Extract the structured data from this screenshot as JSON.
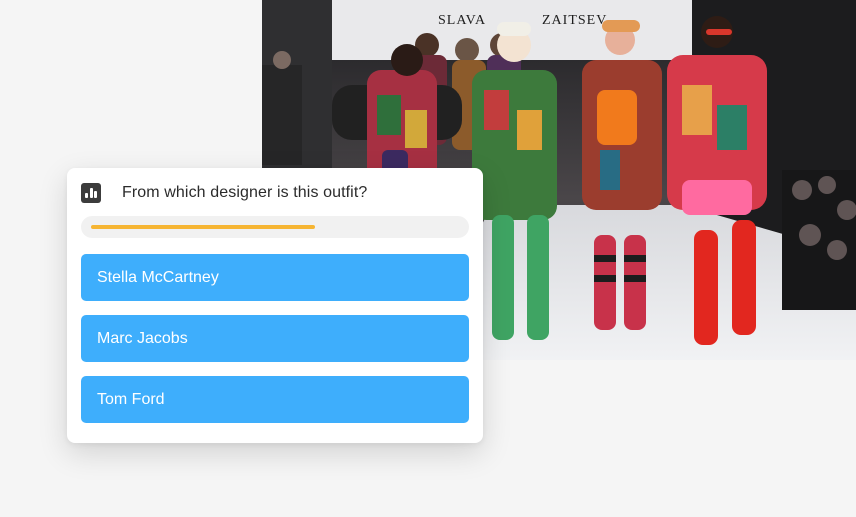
{
  "photo": {
    "kind": "fashion runway photograph",
    "brand_lettering": "SLAVA ZAITSEV"
  },
  "quiz": {
    "icon": "poll-icon",
    "question": "From which designer is this outfit?",
    "progress": 0.61,
    "answers": [
      {
        "label": "Stella McCartney"
      },
      {
        "label": "Marc Jacobs"
      },
      {
        "label": "Tom Ford"
      }
    ]
  },
  "colors": {
    "background": "#f5f5f5",
    "card": "#ffffff",
    "answer_button": "#3eaefc",
    "progress_fill": "#f6b533",
    "progress_track": "#f1f1f1"
  }
}
